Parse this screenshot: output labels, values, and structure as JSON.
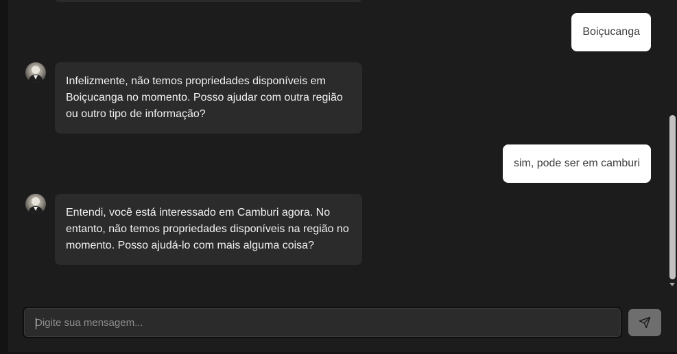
{
  "messages": [
    {
      "role": "user",
      "text": "Boiçucanga"
    },
    {
      "role": "bot",
      "text": "Infelizmente, não temos propriedades disponíveis em Boiçucanga no momento. Posso ajudar com outra região ou outro tipo de informação?"
    },
    {
      "role": "user",
      "text": "sim, pode ser em camburi"
    },
    {
      "role": "bot",
      "text": "Entendi, você está interessado em Camburi agora. No entanto, não temos propriedades disponíveis na região no momento. Posso ajudá-lo com mais alguma coisa?"
    }
  ],
  "composer": {
    "placeholder": "Digite sua mensagem...",
    "value": "",
    "send_icon": "send-icon"
  },
  "colors": {
    "background": "#1c1c1c",
    "bot_bubble": "#2b2b2b",
    "user_bubble": "#ffffff",
    "send_button": "#6e6e6e"
  }
}
